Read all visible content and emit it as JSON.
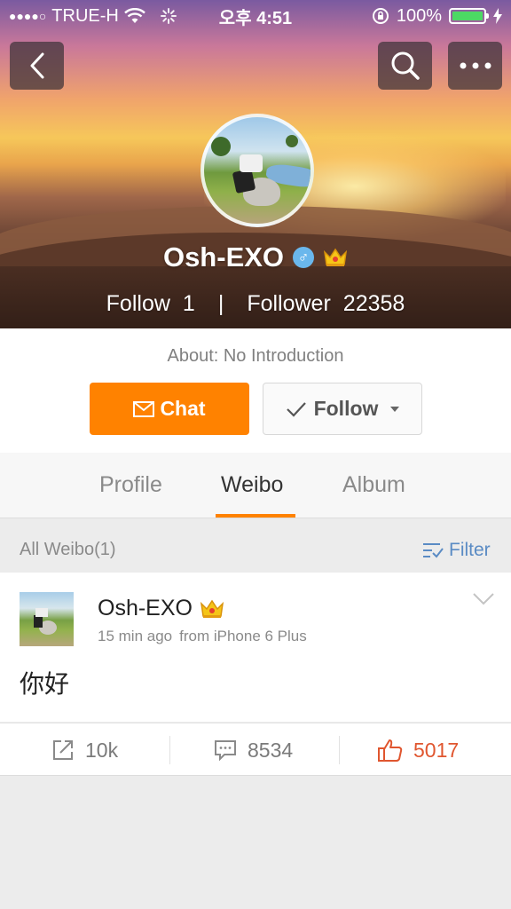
{
  "status_bar": {
    "signal_dots": "●●●●○",
    "carrier": "TRUE-H",
    "time": "오후 4:51",
    "battery": "100%"
  },
  "nav": {
    "back_icon": "back-arrow-icon",
    "search_icon": "search-icon",
    "more_icon": "more-dots-icon"
  },
  "profile": {
    "username": "Osh-EXO",
    "gender_symbol": "♂",
    "follow_label": "Follow",
    "follow_count": "1",
    "separator": "|",
    "follower_label": "Follower",
    "follower_count": "22358",
    "about": "About: No Introduction"
  },
  "buttons": {
    "chat_label": "Chat",
    "follow_label": "Follow"
  },
  "tabs": [
    {
      "label": "Profile",
      "active": false
    },
    {
      "label": "Weibo",
      "active": true
    },
    {
      "label": "Album",
      "active": false
    }
  ],
  "filter_bar": {
    "all_label": "All Weibo(1)",
    "filter_label": "Filter"
  },
  "post": {
    "author": "Osh-EXO",
    "time": "15 min ago",
    "source": "from iPhone 6 Plus",
    "text": "你好",
    "reposts": "10k",
    "comments": "8534",
    "likes": "5017"
  },
  "colors": {
    "accent": "#ff8200",
    "link": "#5a8bc4",
    "like": "#e0562f",
    "gender": "#6ab7ec"
  }
}
